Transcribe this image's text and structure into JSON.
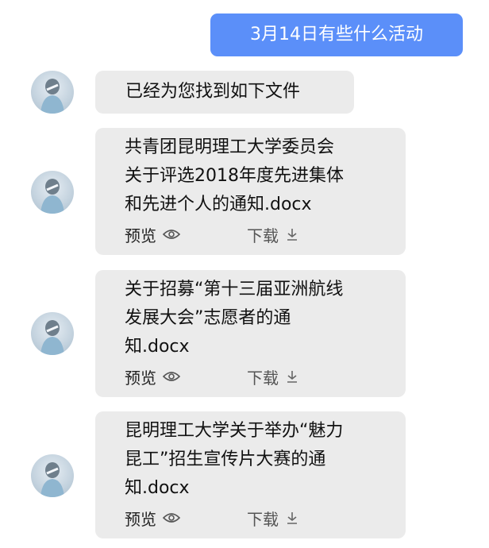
{
  "user_message": "3月14日有些什么活动",
  "bot_intro": "已经为您找到如下文件",
  "files": [
    {
      "name": "共青团昆明理工大学委员会\n关于评选2018年度先进集体\n和先进个人的通知.docx",
      "preview_label": "预览",
      "download_label": "下载"
    },
    {
      "name": "关于招募“第十三届亚洲航线\n发展大会”志愿者的通\n知.docx",
      "preview_label": "预览",
      "download_label": "下载"
    },
    {
      "name": "昆明理工大学关于举办“魅力\n昆工”招生宣传片大赛的通\n知.docx",
      "preview_label": "预览",
      "download_label": "下载"
    }
  ],
  "icons": {
    "preview": "eye-icon",
    "download": "download-icon"
  },
  "colors": {
    "user_bubble": "#5b8ff9",
    "bot_bubble": "#ebebeb"
  }
}
